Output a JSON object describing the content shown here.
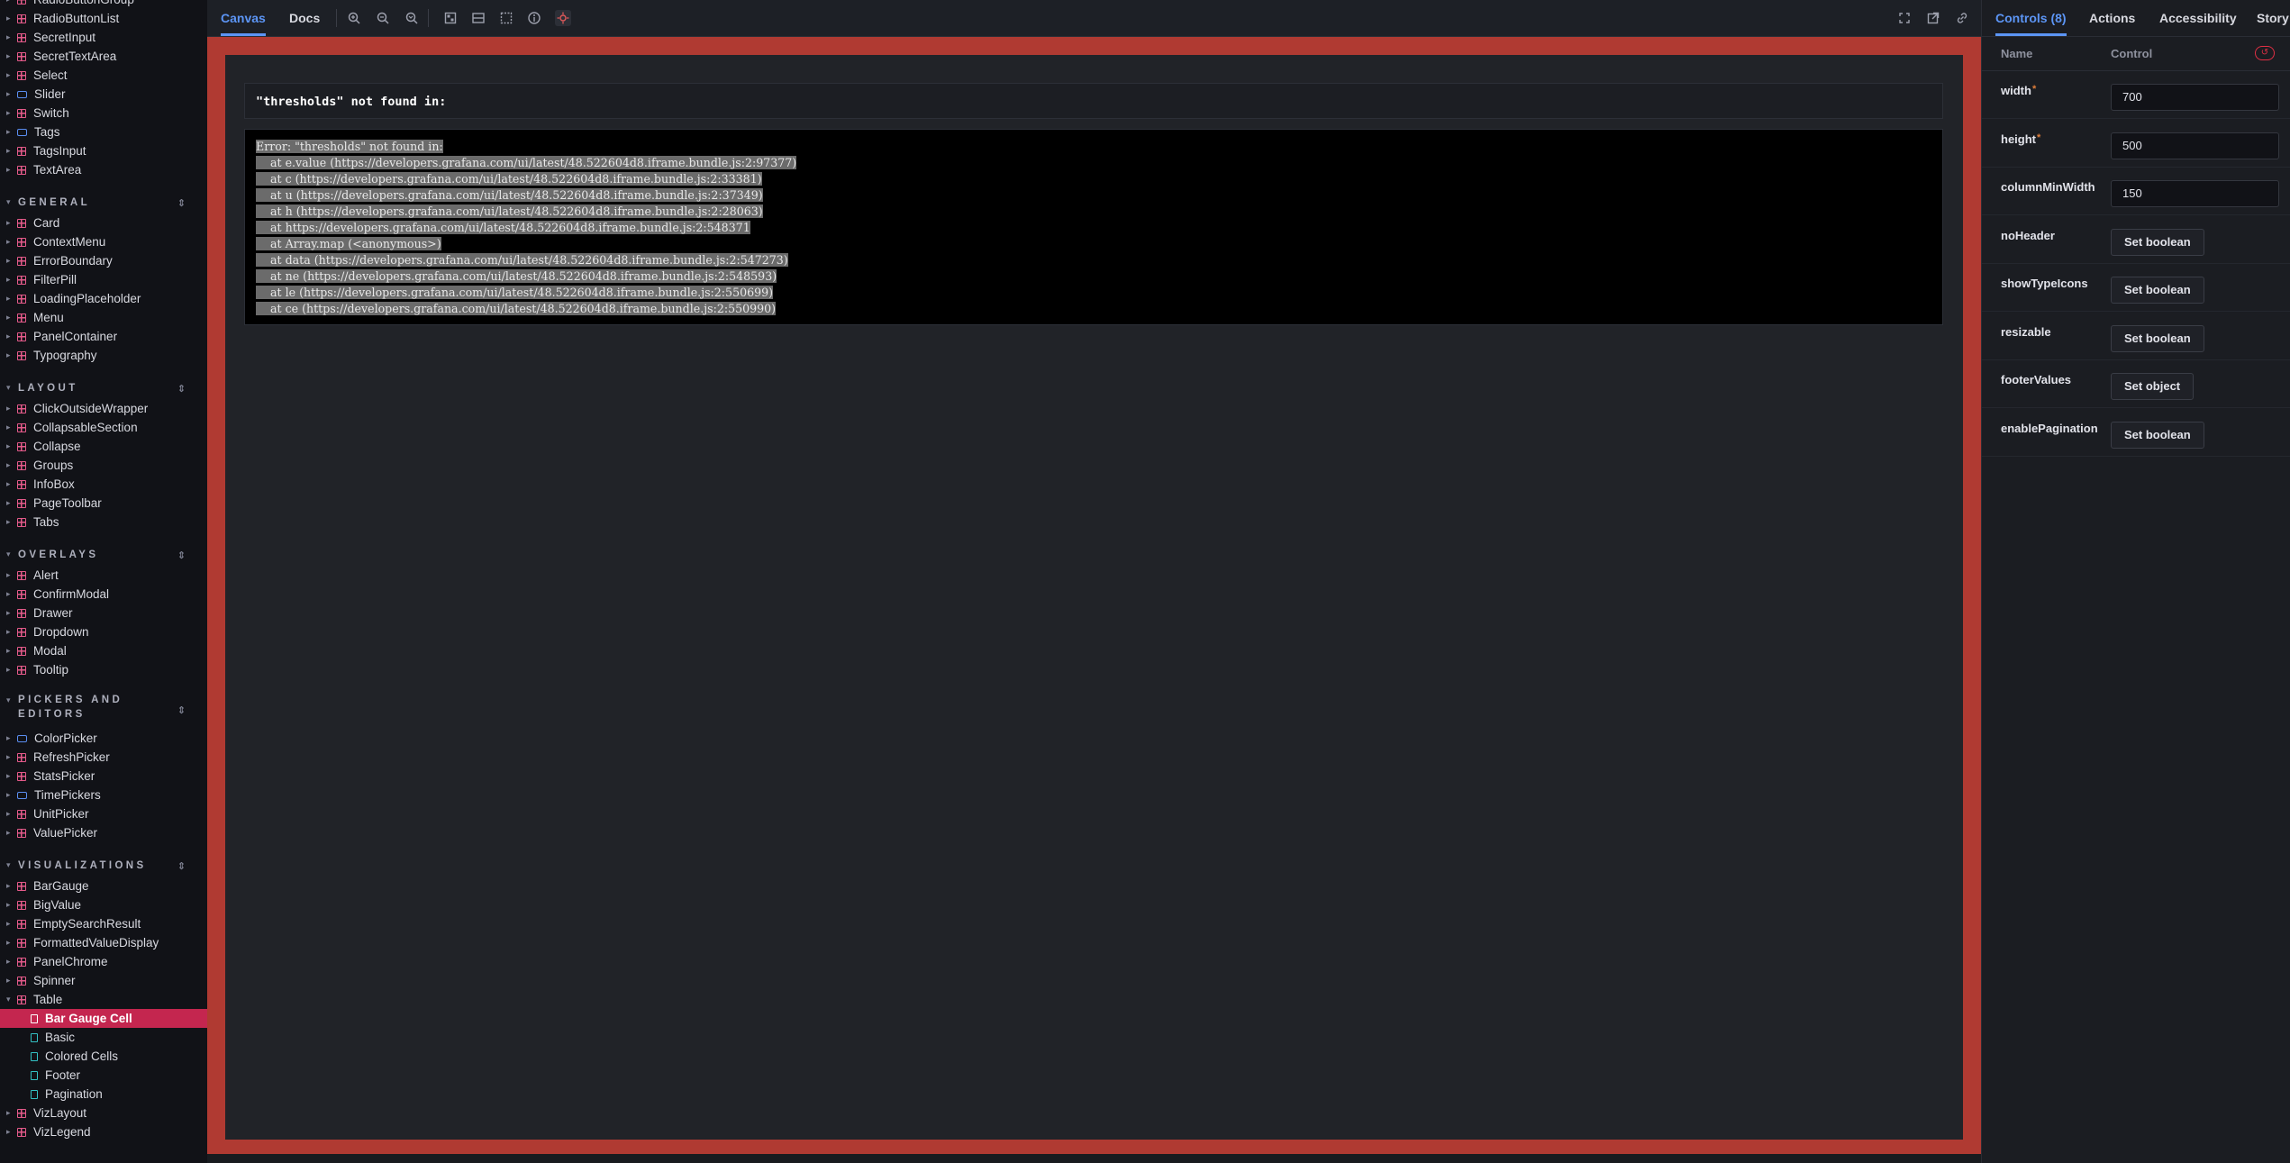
{
  "sidebar": {
    "sections": [
      {
        "heading": null,
        "items": [
          {
            "label": "RadioButtonGroup",
            "icon": "component-icon"
          },
          {
            "label": "RadioButtonList",
            "icon": "component-icon"
          },
          {
            "label": "SecretInput",
            "icon": "component-icon"
          },
          {
            "label": "SecretTextArea",
            "icon": "component-icon"
          },
          {
            "label": "Select",
            "icon": "component-icon"
          },
          {
            "label": "Slider",
            "icon": "folder-icon"
          },
          {
            "label": "Switch",
            "icon": "component-icon"
          },
          {
            "label": "Tags",
            "icon": "folder-icon"
          },
          {
            "label": "TagsInput",
            "icon": "component-icon"
          },
          {
            "label": "TextArea",
            "icon": "component-icon"
          }
        ]
      },
      {
        "heading": "GENERAL",
        "items": [
          {
            "label": "Card",
            "icon": "component-icon"
          },
          {
            "label": "ContextMenu",
            "icon": "component-icon"
          },
          {
            "label": "ErrorBoundary",
            "icon": "component-icon"
          },
          {
            "label": "FilterPill",
            "icon": "component-icon"
          },
          {
            "label": "LoadingPlaceholder",
            "icon": "component-icon"
          },
          {
            "label": "Menu",
            "icon": "component-icon"
          },
          {
            "label": "PanelContainer",
            "icon": "component-icon"
          },
          {
            "label": "Typography",
            "icon": "component-icon"
          }
        ]
      },
      {
        "heading": "LAYOUT",
        "items": [
          {
            "label": "ClickOutsideWrapper",
            "icon": "component-icon"
          },
          {
            "label": "CollapsableSection",
            "icon": "component-icon"
          },
          {
            "label": "Collapse",
            "icon": "component-icon"
          },
          {
            "label": "Groups",
            "icon": "component-icon"
          },
          {
            "label": "InfoBox",
            "icon": "component-icon"
          },
          {
            "label": "PageToolbar",
            "icon": "component-icon"
          },
          {
            "label": "Tabs",
            "icon": "component-icon"
          }
        ]
      },
      {
        "heading": "OVERLAYS",
        "items": [
          {
            "label": "Alert",
            "icon": "component-icon"
          },
          {
            "label": "ConfirmModal",
            "icon": "component-icon"
          },
          {
            "label": "Drawer",
            "icon": "component-icon"
          },
          {
            "label": "Dropdown",
            "icon": "component-icon"
          },
          {
            "label": "Modal",
            "icon": "component-icon"
          },
          {
            "label": "Tooltip",
            "icon": "component-icon"
          }
        ]
      },
      {
        "heading": "PICKERS AND EDITORS",
        "twoline": true,
        "items": [
          {
            "label": "ColorPicker",
            "icon": "folder-icon"
          },
          {
            "label": "RefreshPicker",
            "icon": "component-icon"
          },
          {
            "label": "StatsPicker",
            "icon": "component-icon"
          },
          {
            "label": "TimePickers",
            "icon": "folder-icon"
          },
          {
            "label": "UnitPicker",
            "icon": "component-icon"
          },
          {
            "label": "ValuePicker",
            "icon": "component-icon"
          }
        ]
      },
      {
        "heading": "VISUALIZATIONS",
        "items": [
          {
            "label": "BarGauge",
            "icon": "component-icon"
          },
          {
            "label": "BigValue",
            "icon": "component-icon"
          },
          {
            "label": "EmptySearchResult",
            "icon": "component-icon"
          },
          {
            "label": "FormattedValueDisplay",
            "icon": "component-icon"
          },
          {
            "label": "PanelChrome",
            "icon": "component-icon"
          },
          {
            "label": "Spinner",
            "icon": "component-icon"
          },
          {
            "label": "Table",
            "icon": "component-icon",
            "expanded": true
          },
          {
            "label": "Bar Gauge Cell",
            "icon": "story-icon",
            "story": true,
            "selected": true
          },
          {
            "label": "Basic",
            "icon": "story-icon",
            "story": true
          },
          {
            "label": "Colored Cells",
            "icon": "story-icon",
            "story": true
          },
          {
            "label": "Footer",
            "icon": "story-icon",
            "story": true
          },
          {
            "label": "Pagination",
            "icon": "story-icon",
            "story": true
          },
          {
            "label": "VizLayout",
            "icon": "component-icon"
          },
          {
            "label": "VizLegend",
            "icon": "component-icon"
          }
        ]
      }
    ]
  },
  "toolbar": {
    "tab_canvas": "Canvas",
    "tab_docs": "Docs",
    "icons": [
      "zoom-in-icon",
      "zoom-out-icon",
      "zoom-reset-icon",
      "background-icon",
      "grid-icon",
      "viewport-icon",
      "vision-icon",
      "outline-icon"
    ],
    "right_icons": [
      "fullscreen-icon",
      "open-new-tab-icon",
      "copy-link-icon"
    ]
  },
  "canvas": {
    "error_title": "\"thresholds\" not found in:",
    "error_lines": [
      "Error: \"thresholds\" not found in:",
      "    at e.value (https://developers.grafana.com/ui/latest/48.522604d8.iframe.bundle.js:2:97377)",
      "    at c (https://developers.grafana.com/ui/latest/48.522604d8.iframe.bundle.js:2:33381)",
      "    at u (https://developers.grafana.com/ui/latest/48.522604d8.iframe.bundle.js:2:37349)",
      "    at h (https://developers.grafana.com/ui/latest/48.522604d8.iframe.bundle.js:2:28063)",
      "    at https://developers.grafana.com/ui/latest/48.522604d8.iframe.bundle.js:2:548371",
      "    at Array.map (<anonymous>)",
      "    at data (https://developers.grafana.com/ui/latest/48.522604d8.iframe.bundle.js:2:547273)",
      "    at ne (https://developers.grafana.com/ui/latest/48.522604d8.iframe.bundle.js:2:548593)",
      "    at le (https://developers.grafana.com/ui/latest/48.522604d8.iframe.bundle.js:2:550699)",
      "    at ce (https://developers.grafana.com/ui/latest/48.522604d8.iframe.bundle.js:2:550990)"
    ]
  },
  "panel": {
    "tabs": [
      "Controls (8)",
      "Actions",
      "Accessibility",
      "Story"
    ],
    "col_name": "Name",
    "col_control": "Control",
    "controls": [
      {
        "name": "width",
        "required": true,
        "type": "input",
        "value": "700"
      },
      {
        "name": "height",
        "required": true,
        "type": "input",
        "value": "500"
      },
      {
        "name": "columnMinWidth",
        "required": false,
        "type": "input",
        "value": "150"
      },
      {
        "name": "noHeader",
        "required": false,
        "type": "button",
        "value": "Set boolean"
      },
      {
        "name": "showTypeIcons",
        "required": false,
        "type": "button",
        "value": "Set boolean"
      },
      {
        "name": "resizable",
        "required": false,
        "type": "button",
        "value": "Set boolean"
      },
      {
        "name": "footerValues",
        "required": false,
        "type": "button",
        "value": "Set object"
      },
      {
        "name": "enablePagination",
        "required": false,
        "type": "button",
        "value": "Set boolean"
      }
    ],
    "required_mark": "*"
  },
  "colors": {
    "accent": "#5c95f5",
    "selected": "#c4264f",
    "canvas_border": "#b03a32",
    "danger": "#e02f44"
  }
}
